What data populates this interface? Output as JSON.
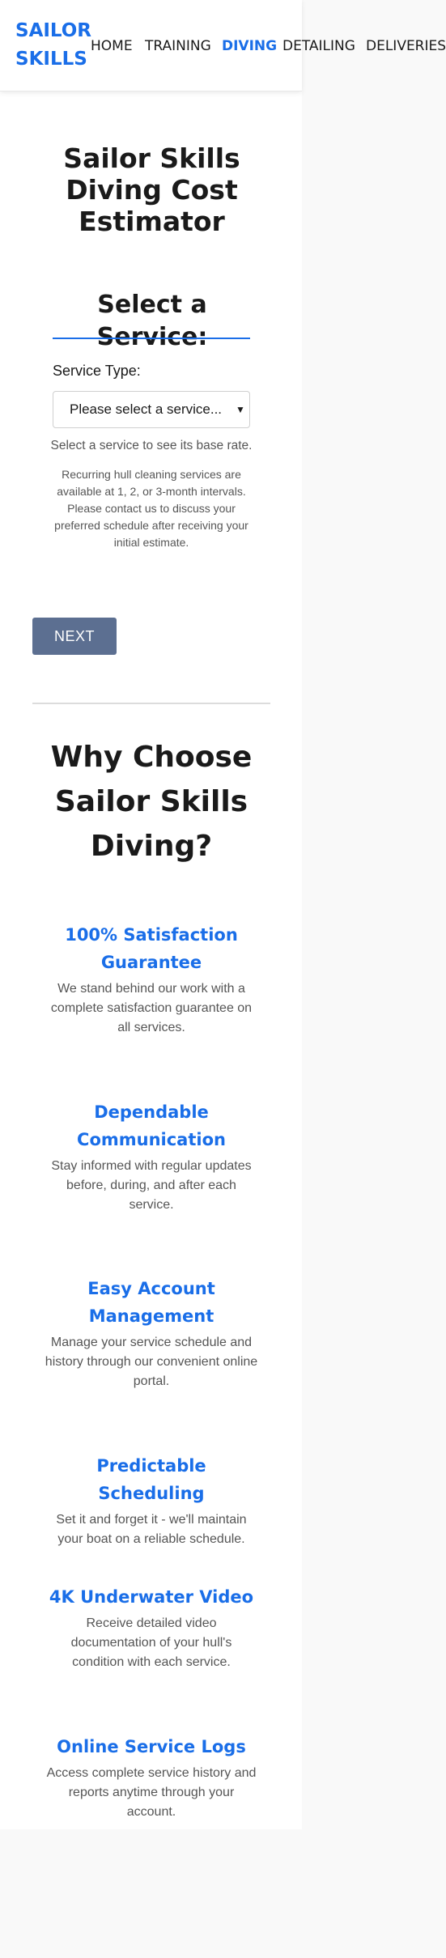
{
  "header": {
    "logo": "SAILOR SKILLS",
    "nav": [
      "HOME",
      "TRAINING",
      "DIVING",
      "DETAILING",
      "DELIVERIES"
    ],
    "active_nav": "DIVING",
    "accent_color": "#1a6ee8"
  },
  "page_title": "Sailor Skills Diving Cost Estimator",
  "service": {
    "heading": "Select a Service:",
    "type_label": "Service Type:",
    "select_value": "Please select a service...",
    "base_rate_hint": "Select a service to see its base rate.",
    "recurring_note": "Recurring hull cleaning services are available at 1, 2, or 3-month intervals. Please contact us to discuss your preferred schedule after receiving your initial estimate."
  },
  "next_button": "NEXT",
  "why": {
    "heading": "Why Choose Sailor Skills Diving?",
    "features": [
      {
        "title": "100% Satisfaction Guarantee",
        "desc": "We stand behind our work with a complete satisfaction guarantee on all services."
      },
      {
        "title": "Dependable Communication",
        "desc": "Stay informed with regular updates before, during, and after each service."
      },
      {
        "title": "Easy Account Management",
        "desc": "Manage your service schedule and history through our convenient online portal."
      },
      {
        "title": "Predictable Scheduling",
        "desc": "Set it and forget it - we'll maintain your boat on a reliable schedule."
      },
      {
        "title": "4K Underwater Video",
        "desc": "Receive detailed video documentation of your hull's condition with each service."
      },
      {
        "title": "Online Service Logs",
        "desc": "Access complete service history and reports anytime through your account."
      }
    ]
  }
}
